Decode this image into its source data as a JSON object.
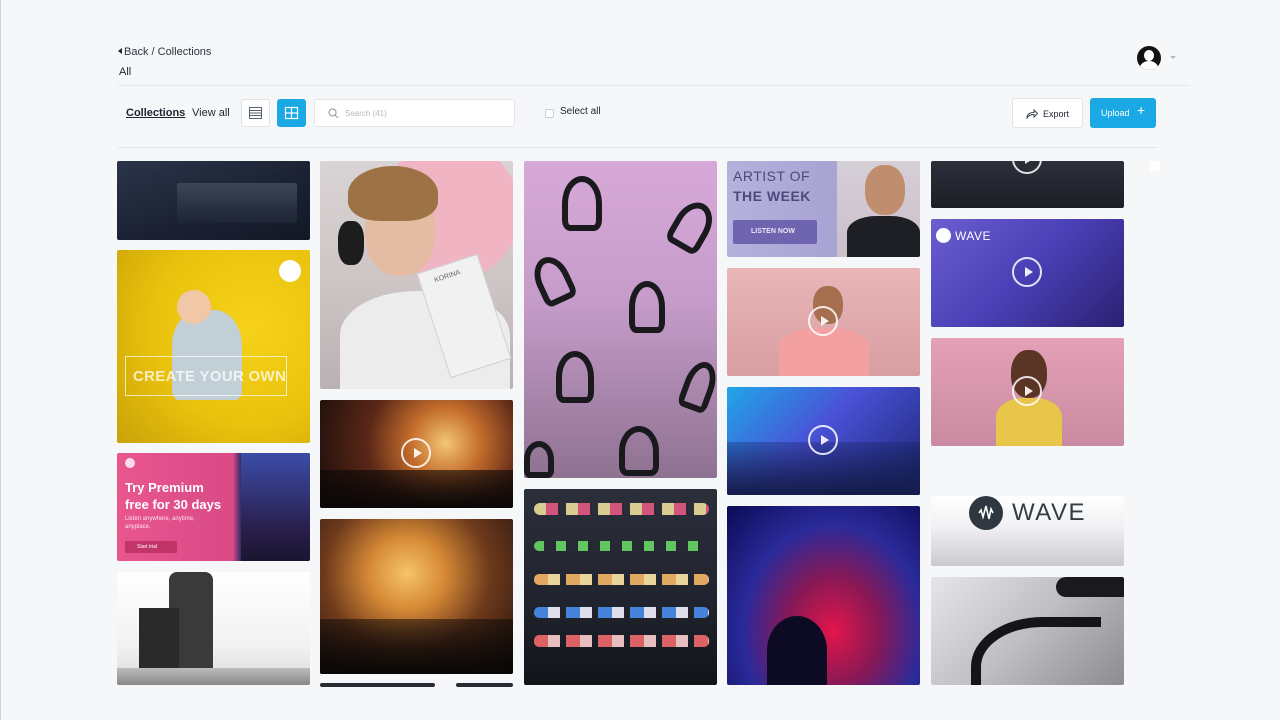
{
  "header": {
    "back_label": "Back / Collections",
    "current_collection": "All"
  },
  "toolbar": {
    "collections_tab": "Collections",
    "view_all_tab": "View all",
    "search_placeholder": "Search (41)",
    "select_all_label": "Select all",
    "export_label": "Export",
    "upload_label": "Upload",
    "upload_icon": "+"
  },
  "colors": {
    "accent": "#1aa9e5",
    "page_background": "#f6f7f9"
  },
  "assets": {
    "create_your_own": "CREATE YOUR OWN",
    "premium_title_1": "Try Premium",
    "premium_title_2": "free for 30 days",
    "premium_sub_1": "Listen anywhere, anytime,",
    "premium_sub_2": "anyplace.",
    "premium_cta": "Start trial",
    "book_title": "KORINA",
    "artist_line_1": "ARTIST OF",
    "artist_line_2": "THE WEEK",
    "artist_cta": "LISTEN NOW",
    "wave_small": "WAVE",
    "wave_large": "WAVE"
  }
}
